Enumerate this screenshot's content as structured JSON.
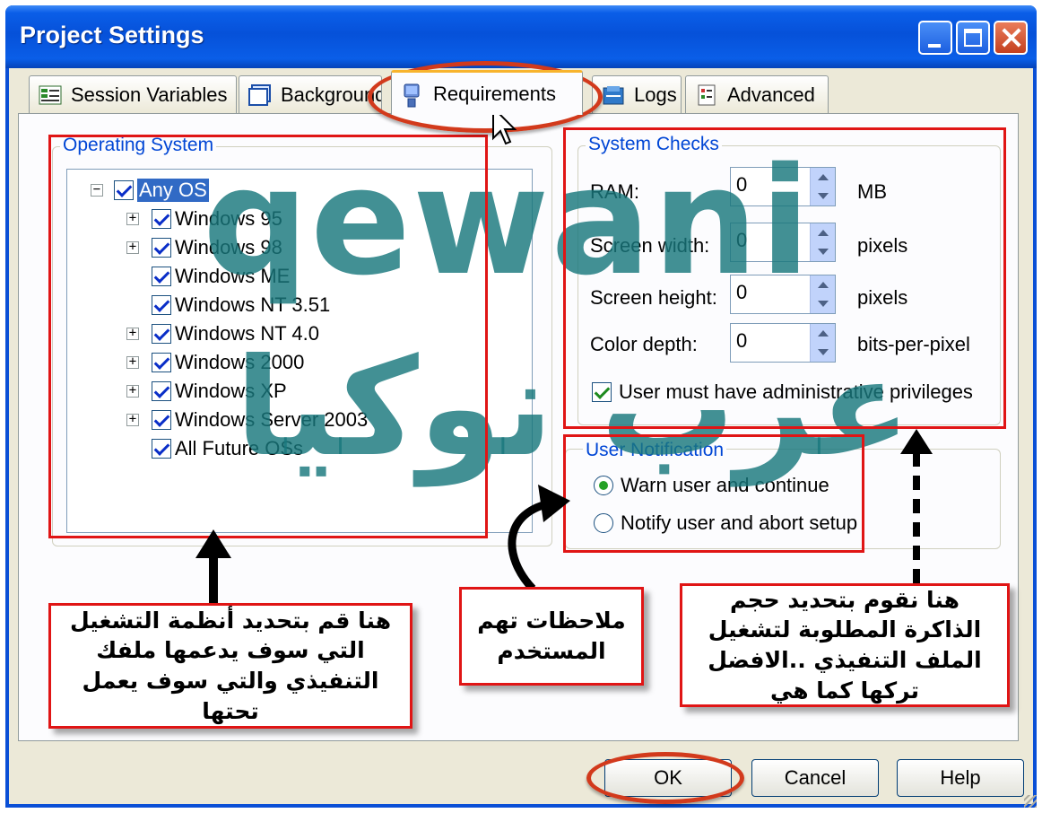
{
  "window": {
    "title": "Project Settings"
  },
  "tabs": [
    {
      "label": "Session Variables",
      "icon": "session-variables-icon"
    },
    {
      "label": "Background",
      "icon": "background-icon"
    },
    {
      "label": "Requirements",
      "icon": "requirements-icon",
      "active": true
    },
    {
      "label": "Logs",
      "icon": "logs-icon"
    },
    {
      "label": "Advanced",
      "icon": "advanced-icon"
    }
  ],
  "os_group": {
    "label": "Operating System",
    "tree": [
      {
        "label": "Any OS",
        "checked": true,
        "selected": true,
        "expander": "minus"
      },
      {
        "label": "Windows 95",
        "checked": true,
        "expander": "plus"
      },
      {
        "label": "Windows 98",
        "checked": true,
        "expander": "plus"
      },
      {
        "label": "Windows ME",
        "checked": true
      },
      {
        "label": "Windows NT 3.51",
        "checked": true
      },
      {
        "label": "Windows NT 4.0",
        "checked": true,
        "expander": "plus"
      },
      {
        "label": "Windows 2000",
        "checked": true,
        "expander": "plus"
      },
      {
        "label": "Windows XP",
        "checked": true,
        "expander": "plus"
      },
      {
        "label": "Windows Server 2003",
        "checked": true,
        "expander": "plus"
      },
      {
        "label": "All Future OSs",
        "checked": true
      }
    ]
  },
  "system_checks": {
    "label": "System Checks",
    "fields": [
      {
        "label": "RAM:",
        "value": "0",
        "unit": "MB"
      },
      {
        "label": "Screen width:",
        "value": "0",
        "unit": "pixels"
      },
      {
        "label": "Screen height:",
        "value": "0",
        "unit": "pixels"
      },
      {
        "label": "Color depth:",
        "value": "0",
        "unit": "bits-per-pixel"
      }
    ],
    "admin_checkbox": {
      "label": "User must have administrative privileges",
      "checked": true
    }
  },
  "user_notification": {
    "label": "User Notification",
    "options": [
      {
        "label": "Warn user and continue",
        "selected": true
      },
      {
        "label": "Notify user and abort setup",
        "selected": false
      }
    ]
  },
  "buttons": {
    "ok": "OK",
    "cancel": "Cancel",
    "help": "Help"
  },
  "annotations": {
    "os_note": "هنا قم بتحديد أنظمة التشغيل التي سوف يدعمها ملفك التنفيذي والتي سوف يعمل تحتها",
    "notification_note": "ملاحظات تهم المستخدم",
    "checks_note": "هنا نقوم بتحديد حجم الذاكرة المطلوبة لتشغيل الملف التنفيذي ..الافضل تركها كما هي"
  },
  "watermark": {
    "latin": "qewani",
    "arabic": "عرب نوكيا"
  },
  "colors": {
    "title_bar": "#0651d9",
    "group_label": "#0046d5",
    "highlight_red": "#e01515",
    "watermark": "#19787d"
  }
}
